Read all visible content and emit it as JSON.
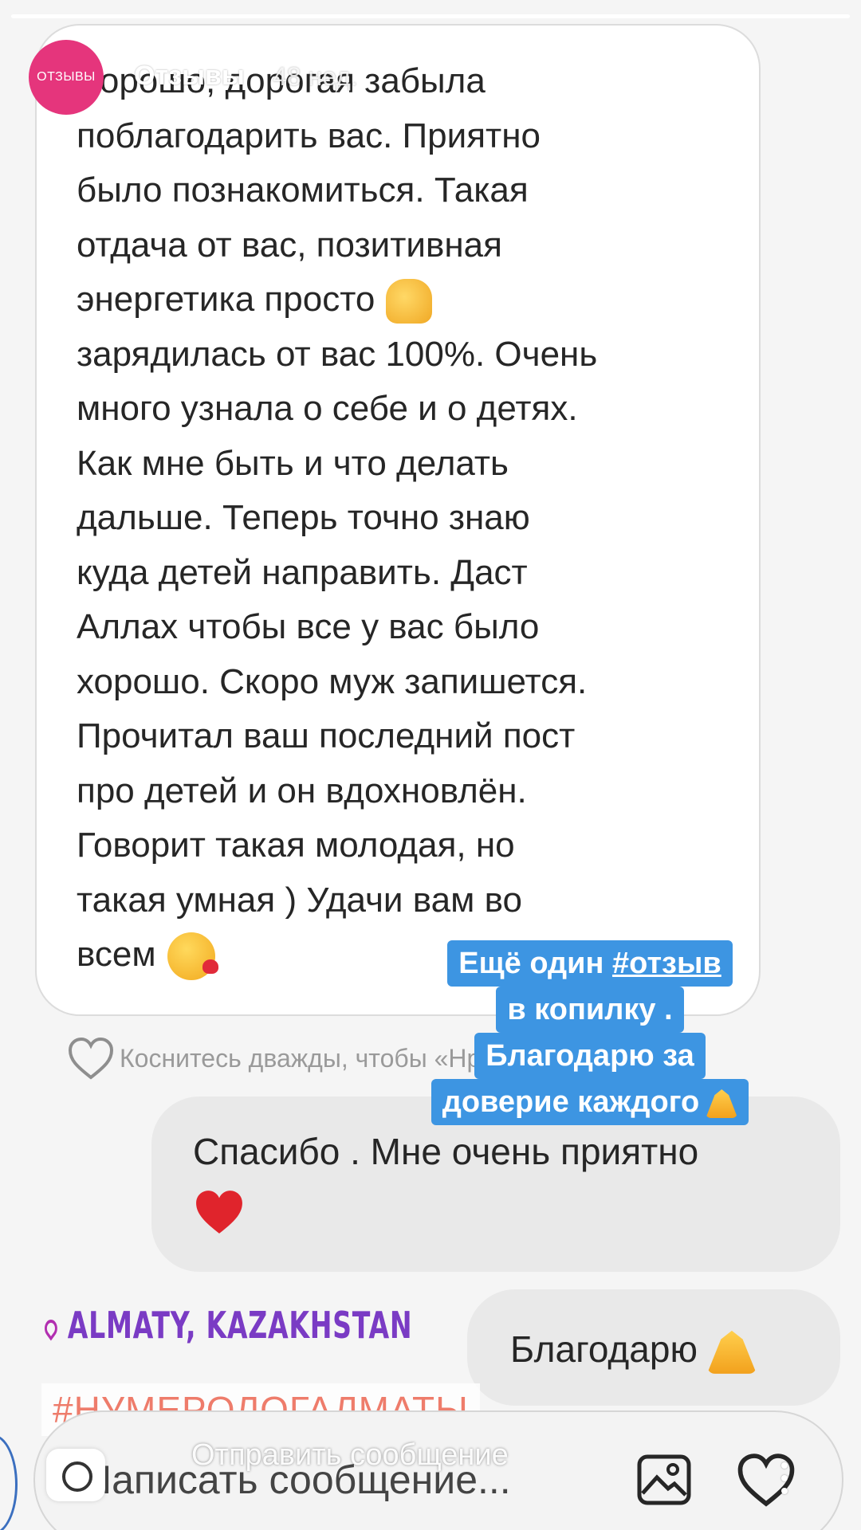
{
  "story": {
    "progress": 1.0,
    "avatar_label": "ОТЗЫВЫ",
    "account_name": "Отзывы",
    "time_ago": "48 нед."
  },
  "message": {
    "text": "Хорошо, дорогая забыла\nпоблагодарить вас. Приятно\nбыло познакомиться. Такая\nотдача от вас, позитивная\nэнергетика просто",
    "text_2": "\nзарядилась от вас 100%. Очень\nмного узнала о себе и о детях.\nКак мне быть и что делать\nдальше. Теперь точно знаю\nкуда детей направить. Даст\nАллах чтобы все у вас было\nхорошо. Скоро муж запишется.\nПрочитал ваш последний пост\nпро детей и он вдохновлён.\nГоворит такая молодая, но\nтакая умная ) Удачи вам во\nвсем",
    "emoji_1": "thumbs-up",
    "emoji_2": "kissing-face"
  },
  "like_hint": "Коснитесь дважды, чтобы «Нравится»",
  "caption": {
    "line1_prefix": "Ещё один ",
    "line1_tag": "#отзыв",
    "line2": "в копилку .",
    "line3": "Благодарю за",
    "line4": "доверие каждого"
  },
  "replies": [
    {
      "text": "Спасибо . Мне очень приятно",
      "emoji": "red-heart"
    },
    {
      "text": "Благодарю",
      "emoji": "folded-hands"
    }
  ],
  "location_sticker": "ALMATY, KAZAKHSTAN",
  "hashtag_sticker": "#НУМЕРОЛОГАЛМАТЫ",
  "composer": {
    "placeholder": "Написать сообщение..."
  },
  "story_reply": {
    "placeholder": "Отправить сообщение"
  },
  "colors": {
    "avatar": "#e5357c",
    "caption_highlight": "#3d95e2",
    "location": "#7a3bc4",
    "hashtag": "#ee7c6b",
    "bubble_out": "#e9e9e9"
  }
}
